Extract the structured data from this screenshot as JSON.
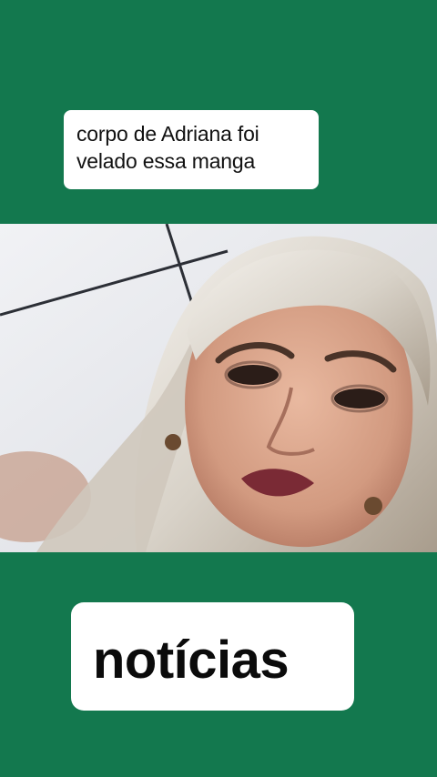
{
  "caption": {
    "lines": [
      "corpo de Adriana foi",
      "velado essa manga"
    ]
  },
  "headline": "notícias",
  "colors": {
    "background": "#13784e",
    "box": "#ffffff",
    "text": "#111111"
  },
  "video": {
    "description_icon": "video-frame-woman-selfie"
  }
}
